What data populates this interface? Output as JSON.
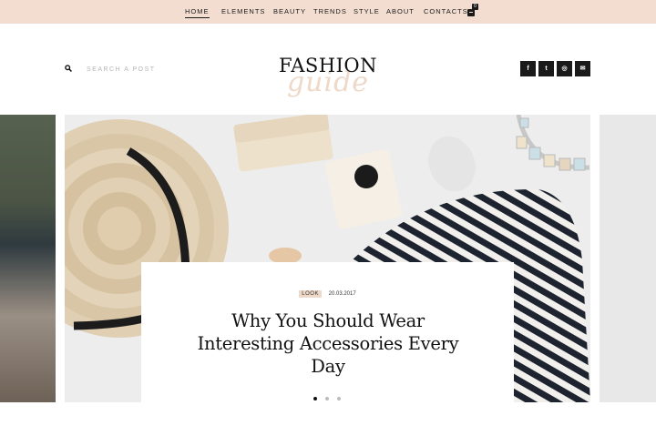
{
  "nav": {
    "items": [
      {
        "label": "HOME",
        "active": true
      },
      {
        "label": "ELEMENTS",
        "active": false
      },
      {
        "label": "BEAUTY",
        "active": false
      },
      {
        "label": "TRENDS",
        "active": false
      },
      {
        "label": "STYLE",
        "active": false
      },
      {
        "label": "ABOUT",
        "active": false
      },
      {
        "label": "CONTACTS",
        "active": false
      }
    ],
    "cart": {
      "icon": "shopping-bag-icon",
      "count": "0"
    }
  },
  "search": {
    "placeholder": "SEARCH A POST",
    "icon": "search-icon"
  },
  "logo": {
    "main": "FASHION",
    "script": "guide"
  },
  "socials": [
    {
      "icon": "facebook-icon",
      "glyph": "f"
    },
    {
      "icon": "twitter-icon",
      "glyph": "t"
    },
    {
      "icon": "instagram-icon",
      "glyph": "◎"
    },
    {
      "icon": "email-icon",
      "glyph": "✉"
    }
  ],
  "slide": {
    "tag": "LOOK",
    "date": "20.03.2017",
    "title": "Why You Should Wear Interesting Accessories Every Day",
    "dots": 3,
    "active_dot": 0
  },
  "colors": {
    "topbar": "#f2ddd0",
    "accent": "#eed8c8",
    "text": "#111111"
  }
}
